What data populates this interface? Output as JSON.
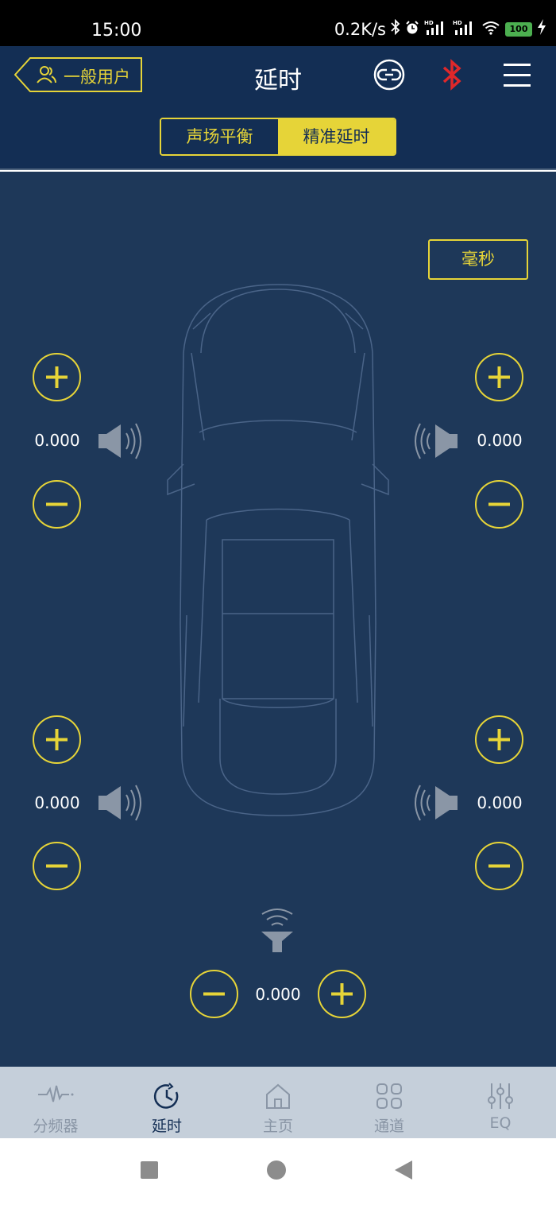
{
  "status_bar": {
    "time": "15:00",
    "speed": "0.2K/s",
    "battery": "100"
  },
  "header": {
    "user_label": "一般用户",
    "title": "延时"
  },
  "segment": {
    "left": "声场平衡",
    "right": "精准延时"
  },
  "unit_button": "毫秒",
  "channels": {
    "front_left": "0.000",
    "front_right": "0.000",
    "rear_left": "0.000",
    "rear_right": "0.000",
    "subwoofer": "0.000"
  },
  "bottom_nav": [
    {
      "label": "分频器"
    },
    {
      "label": "延时"
    },
    {
      "label": "主页"
    },
    {
      "label": "通道"
    },
    {
      "label": "EQ"
    }
  ],
  "colors": {
    "accent": "#e6d438",
    "header_bg": "#132e54",
    "main_bg": "#1e3859",
    "bluetooth": "#e0282a"
  }
}
